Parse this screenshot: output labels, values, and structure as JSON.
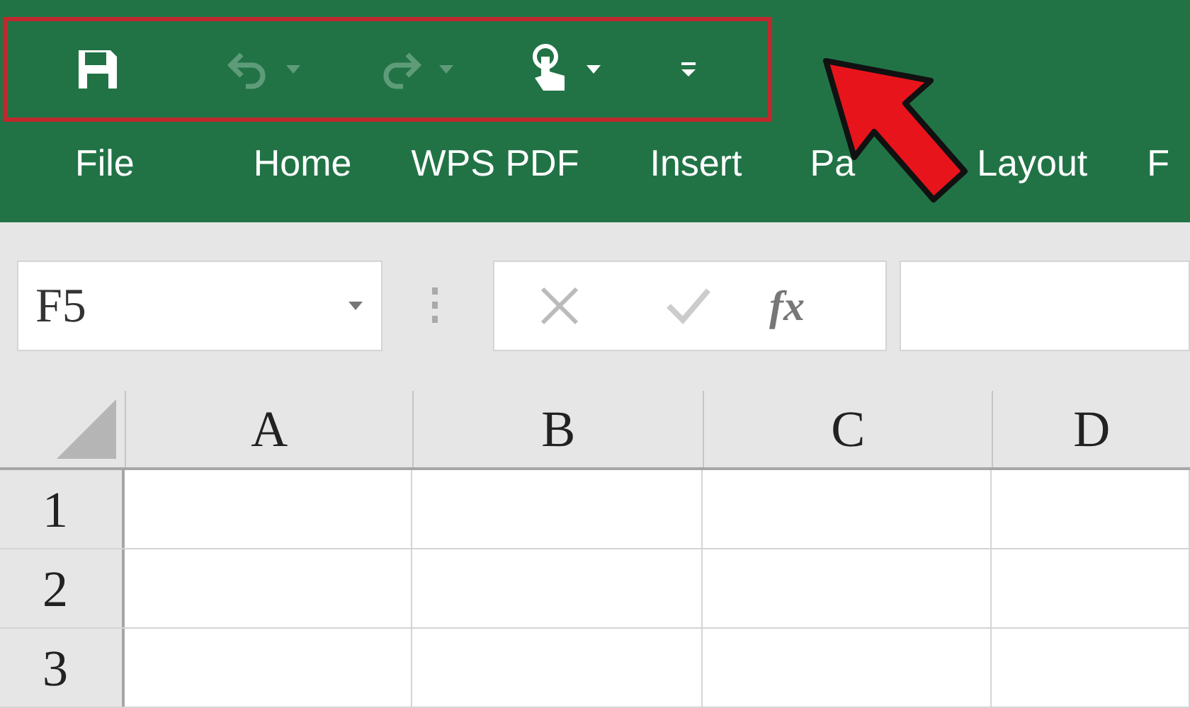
{
  "quick_access_toolbar": {
    "highlighted": true,
    "items": [
      {
        "kind": "save",
        "disabled": false,
        "dropdown": false
      },
      {
        "kind": "undo",
        "disabled": true,
        "dropdown": true
      },
      {
        "kind": "redo",
        "disabled": true,
        "dropdown": true
      },
      {
        "kind": "touch",
        "disabled": false,
        "dropdown": true
      },
      {
        "kind": "customize",
        "disabled": false,
        "dropdown": false
      }
    ]
  },
  "ribbon_tabs": [
    {
      "label": "File"
    },
    {
      "label": "Home"
    },
    {
      "label": "WPS PDF"
    },
    {
      "label": "Insert"
    },
    {
      "label": "Pa"
    },
    {
      "label": "Layout"
    },
    {
      "label": "F"
    }
  ],
  "name_box": {
    "value": "F5"
  },
  "formula_bar": {
    "fx": "fx"
  },
  "annotation_arrow": true,
  "sheet": {
    "columns": [
      "A",
      "B",
      "C",
      "D"
    ],
    "rows": [
      "1",
      "2",
      "3"
    ]
  }
}
